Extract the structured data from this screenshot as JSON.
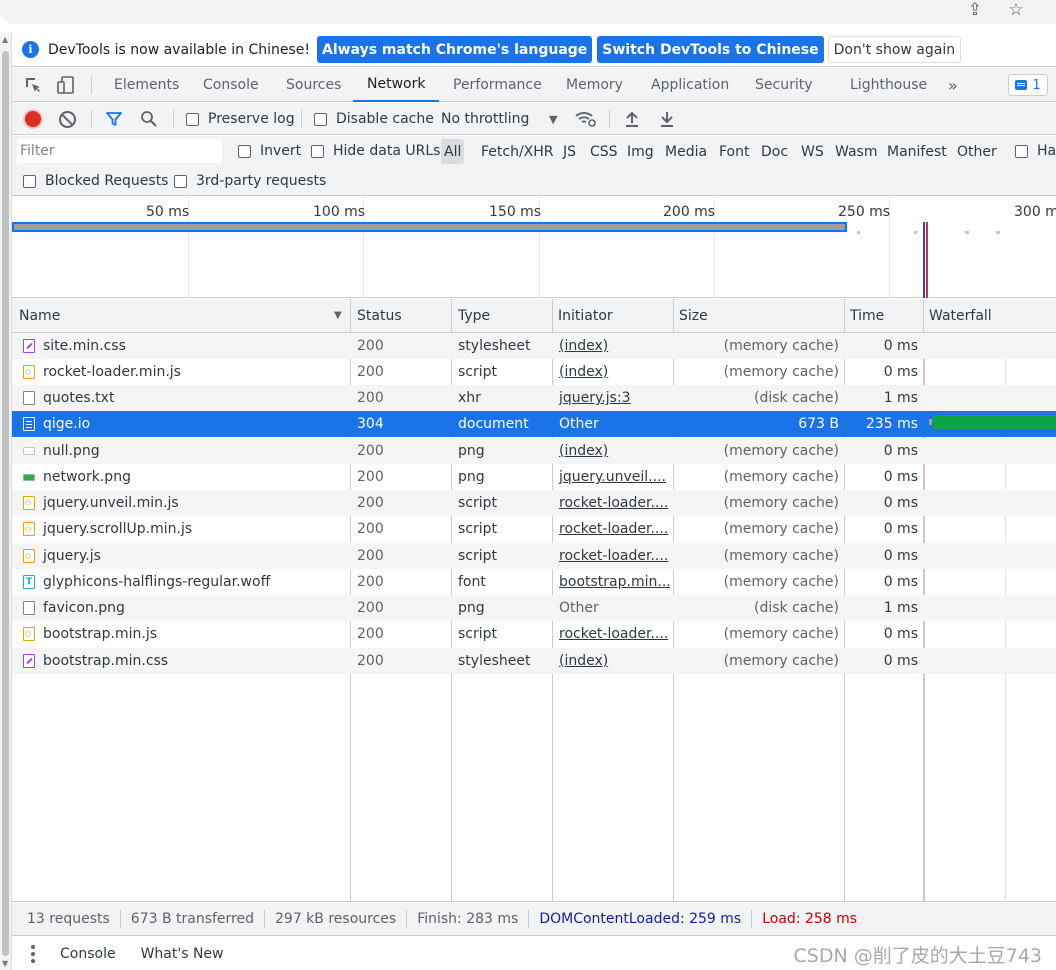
{
  "infobar": {
    "message": "DevTools is now available in Chinese!",
    "btn_match": "Always match Chrome's language",
    "btn_switch": "Switch DevTools to Chinese",
    "btn_dismiss": "Don't show again"
  },
  "tabs": [
    "Elements",
    "Console",
    "Sources",
    "Network",
    "Performance",
    "Memory",
    "Application",
    "Security",
    "Lighthouse"
  ],
  "active_tab": "Network",
  "more_tabs": "»",
  "issues_count": "1",
  "toolbar": {
    "preserve_log": "Preserve log",
    "disable_cache": "Disable cache",
    "throttling": "No throttling",
    "throttling_arrow": "▼"
  },
  "filter": {
    "placeholder": "Filter",
    "invert": "Invert",
    "hide_data_urls": "Hide data URLs",
    "types": [
      "All",
      "Fetch/XHR",
      "JS",
      "CSS",
      "Img",
      "Media",
      "Font",
      "Doc",
      "WS",
      "Wasm",
      "Manifest",
      "Other"
    ],
    "has_blocked_cookies": "Ha",
    "blocked_requests": "Blocked Requests",
    "third_party": "3rd-party requests"
  },
  "overview": {
    "ticks": [
      "50 ms",
      "100 ms",
      "150 ms",
      "200 ms",
      "250 ms",
      "300 m"
    ]
  },
  "columns": {
    "name": "Name",
    "status": "Status",
    "type": "Type",
    "initiator": "Initiator",
    "size": "Size",
    "time": "Time",
    "waterfall": "Waterfall"
  },
  "requests": [
    {
      "name": "site.min.css",
      "status": "200",
      "type": "stylesheet",
      "initiator": "(index)",
      "size": "(memory cache)",
      "time": "0 ms",
      "icon": "css-file-icon"
    },
    {
      "name": "rocket-loader.min.js",
      "status": "200",
      "type": "script",
      "initiator": "(index)",
      "size": "(memory cache)",
      "time": "0 ms",
      "icon": "js-file-icon"
    },
    {
      "name": "quotes.txt",
      "status": "200",
      "type": "xhr",
      "initiator": "jquery.js:3",
      "size": "(disk cache)",
      "time": "1 ms",
      "icon": "file-icon"
    },
    {
      "name": "qige.io",
      "status": "304",
      "type": "document",
      "initiator": "Other",
      "size": "673 B",
      "time": "235 ms",
      "icon": "document-icon"
    },
    {
      "name": "null.png",
      "status": "200",
      "type": "png",
      "initiator": "(index)",
      "size": "(memory cache)",
      "time": "0 ms",
      "icon": "image-icon"
    },
    {
      "name": "network.png",
      "status": "200",
      "type": "png",
      "initiator": "jquery.unveil....",
      "size": "(memory cache)",
      "time": "0 ms",
      "icon": "image-green-icon"
    },
    {
      "name": "jquery.unveil.min.js",
      "status": "200",
      "type": "script",
      "initiator": "rocket-loader....",
      "size": "(memory cache)",
      "time": "0 ms",
      "icon": "js-file-icon"
    },
    {
      "name": "jquery.scrollUp.min.js",
      "status": "200",
      "type": "script",
      "initiator": "rocket-loader....",
      "size": "(memory cache)",
      "time": "0 ms",
      "icon": "js-file-icon"
    },
    {
      "name": "jquery.js",
      "status": "200",
      "type": "script",
      "initiator": "rocket-loader....",
      "size": "(memory cache)",
      "time": "0 ms",
      "icon": "js-file-icon"
    },
    {
      "name": "glyphicons-halflings-regular.woff",
      "status": "200",
      "type": "font",
      "initiator": "bootstrap.min....",
      "size": "(memory cache)",
      "time": "0 ms",
      "icon": "font-file-icon"
    },
    {
      "name": "favicon.png",
      "status": "200",
      "type": "png",
      "initiator": "Other",
      "size": "(disk cache)",
      "time": "1 ms",
      "icon": "file-icon"
    },
    {
      "name": "bootstrap.min.js",
      "status": "200",
      "type": "script",
      "initiator": "rocket-loader....",
      "size": "(memory cache)",
      "time": "0 ms",
      "icon": "js-file-icon"
    },
    {
      "name": "bootstrap.min.css",
      "status": "200",
      "type": "stylesheet",
      "initiator": "(index)",
      "size": "(memory cache)",
      "time": "0 ms",
      "icon": "css-file-icon"
    }
  ],
  "selected_request": "qige.io",
  "summary": {
    "requests": "13 requests",
    "transferred": "673 B transferred",
    "resources": "297 kB resources",
    "finish": "Finish: 283 ms",
    "dom_content_loaded": "DOMContentLoaded: 259 ms",
    "load": "Load: 258 ms"
  },
  "drawer": {
    "tabs": [
      "Console",
      "What's New"
    ]
  },
  "watermark": "CSDN @削了皮的大土豆743",
  "colors": {
    "accent": "#1a73e8",
    "record": "#d93025",
    "waterfall_bar": "#0ca645",
    "dcl": "#1a1aa6",
    "load": "#c80000"
  }
}
